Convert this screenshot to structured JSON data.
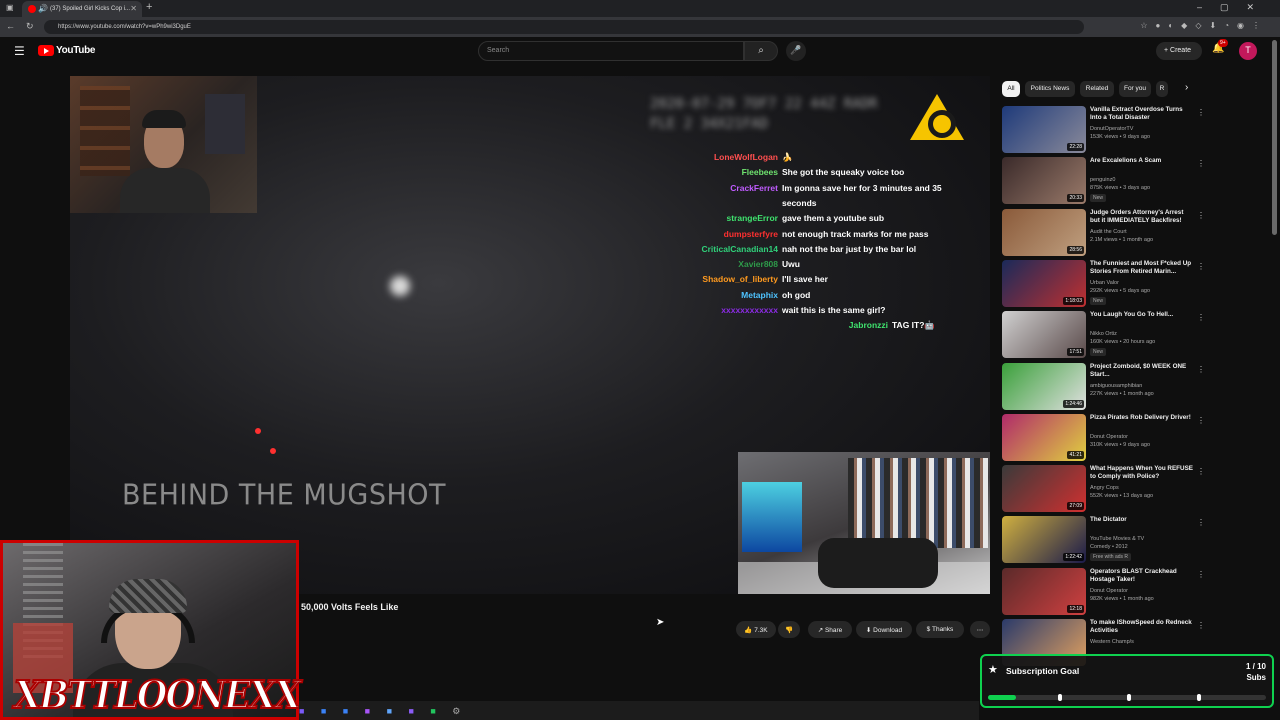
{
  "browser": {
    "tab_title": "(37) Spoiled Girl Kicks Cop i...",
    "url": "https://www.youtube.com/watch?v=wPh9wi3DguE"
  },
  "youtube": {
    "logo_text": "YouTube",
    "search_placeholder": "Search",
    "create_label": "+ Create",
    "notif_count": "9+",
    "avatar_letter": "T"
  },
  "video": {
    "overlay_text": "BEHIND THE MUGSHOT",
    "blurred_header": "2020-07-29 7OF7 22 44Z RADR FLE 2 34X21FAD",
    "title": "50,000 Volts Feels Like",
    "chat": [
      {
        "user": "LoneWolfLogan",
        "msg": "🍌",
        "color": "#ff4f4f"
      },
      {
        "user": "Fleebees",
        "msg": "She got the squeaky voice too",
        "color": "#6fe36f"
      },
      {
        "user": "CrackFerret",
        "msg": "Im gonna save her for 3 minutes and 35",
        "color": "#c05cff"
      },
      {
        "user": "",
        "msg": "seconds",
        "color": "#ffffff"
      },
      {
        "user": "strangeError",
        "msg": "gave them a youtube sub",
        "color": "#3fe36e"
      },
      {
        "user": "dumpsterfyre",
        "msg": "not enough track marks for me pass",
        "color": "#ff3030"
      },
      {
        "user": "CriticalCanadian14",
        "msg": "nah not the bar just by the bar lol",
        "color": "#30d07a"
      },
      {
        "user": "Xavier808",
        "msg": "Uwu",
        "color": "#2e9b4a"
      },
      {
        "user": "Shadow_of_liberty",
        "msg": "I'll save her",
        "color": "#ff9a1f"
      },
      {
        "user": "Metaphix",
        "msg": "oh god",
        "color": "#4ec3ff"
      },
      {
        "user": "xxxxxxxxxxxx",
        "msg": "wait this is the same girl?",
        "color": "#8a2be2"
      },
      {
        "user": "Jabronzzi",
        "msg": "TAG IT?🤖",
        "color": "#3fe36e"
      }
    ]
  },
  "actions": {
    "likes": "7.3K",
    "share": "Share",
    "download": "Download",
    "thanks": "Thanks"
  },
  "chips": [
    "All",
    "Politics News",
    "Related",
    "For you",
    "R"
  ],
  "recommendations": [
    {
      "title": "Vanilla Extract Overdose Turns Into a Total Disaster",
      "channel": "DonutOperatorTV",
      "meta": "153K views • 9 days ago",
      "dur": "22:28",
      "badge": "",
      "thumb": [
        "#1e3a7a",
        "#8a8a9a"
      ]
    },
    {
      "title": "Are Excalelions A Scam",
      "channel": "penguinz0",
      "meta": "875K views • 3 days ago",
      "dur": "20:33",
      "badge": "New",
      "thumb": [
        "#3a2a2a",
        "#9a7a6a"
      ]
    },
    {
      "title": "Judge Orders Attorney's Arrest but it IMMEDIATELY Backfires!",
      "channel": "Audit the Court",
      "meta": "2.1M views • 1 month ago",
      "dur": "28:56",
      "badge": "",
      "thumb": [
        "#8a5a3a",
        "#c0a080"
      ]
    },
    {
      "title": "The Funniest and Most F*cked Up Stories From Retired Marin...",
      "channel": "Urban Valor",
      "meta": "292K views • 5 days ago",
      "dur": "1:18:03",
      "badge": "New",
      "thumb": [
        "#1a2a5a",
        "#c03030"
      ]
    },
    {
      "title": "You Laugh You Go To Hell...",
      "channel": "Nikko Ortiz",
      "meta": "160K views • 20 hours ago",
      "dur": "17:51",
      "badge": "New",
      "thumb": [
        "#d0d0d0",
        "#5a4a4a"
      ]
    },
    {
      "title": "Project Zomboid, $0 WEEK ONE Start...",
      "channel": "ambiguousamphibian",
      "meta": "227K views • 1 month ago",
      "dur": "1:24:46",
      "badge": "",
      "thumb": [
        "#3aa03a",
        "#e0e0e0"
      ]
    },
    {
      "title": "Pizza Pirates Rob Delivery Driver!",
      "channel": "Donut Operator",
      "meta": "310K views • 9 days ago",
      "dur": "41:21",
      "badge": "",
      "thumb": [
        "#b02a6a",
        "#e0d040"
      ]
    },
    {
      "title": "What Happens When You REFUSE to Comply with Police?",
      "channel": "Angry Cops",
      "meta": "552K views • 13 days ago",
      "dur": "27:09",
      "badge": "",
      "thumb": [
        "#3a3a3a",
        "#d03030"
      ]
    },
    {
      "title": "The Dictator",
      "channel": "YouTube Movies & TV",
      "meta": "Comedy • 2012",
      "dur": "1:22:42",
      "badge": "Free with ads   R",
      "thumb": [
        "#d0b040",
        "#1a1a4a"
      ]
    },
    {
      "title": "Operators BLAST Crackhead Hostage Taker!",
      "channel": "Donut Operator",
      "meta": "982K views • 1 month ago",
      "dur": "12:18",
      "badge": "",
      "thumb": [
        "#5a2a2a",
        "#d04040"
      ]
    },
    {
      "title": "To make IShowSpeed do Redneck Activities",
      "channel": "Western Champ/s",
      "meta": "",
      "dur": "",
      "badge": "",
      "thumb": [
        "#2a3a6a",
        "#e0a060"
      ]
    }
  ],
  "overlay": {
    "brand": "XBTTLOONEXX",
    "goal_label": "Subscription Goal",
    "goal_count": "1 / 10",
    "goal_unit": "Subs",
    "goal_progress": 0.1,
    "goal_ticks": [
      0.25,
      0.5,
      0.75
    ]
  },
  "colors": {
    "accent": "#ff0000",
    "goal_green": "#0fd14f",
    "facecam_border": "#cc0000"
  }
}
